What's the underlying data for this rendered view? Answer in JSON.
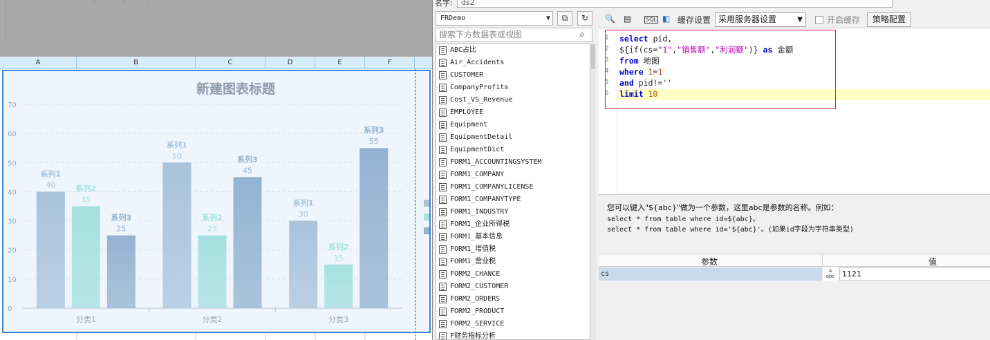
{
  "designer": {
    "columns": [
      "A",
      "B",
      "C",
      "D",
      "E",
      "F"
    ]
  },
  "chart": {
    "title": "新建图表标题",
    "y_ticks": [
      "70",
      "60",
      "50",
      "40",
      "30",
      "20",
      "10",
      "0"
    ]
  },
  "chart_data": {
    "type": "bar",
    "title": "新建图表标题",
    "categories": [
      "分类1",
      "分类2",
      "分类3"
    ],
    "series": [
      {
        "name": "系列1",
        "values": [
          40,
          50,
          30
        ],
        "color": "#a9c3dc"
      },
      {
        "name": "系列2",
        "values": [
          35,
          25,
          15
        ],
        "color": "#a6e0e0"
      },
      {
        "name": "系列3",
        "values": [
          25,
          45,
          55
        ],
        "color": "#94b3d2"
      }
    ],
    "ylim": [
      0,
      70
    ],
    "grid": true,
    "legend": "right"
  },
  "dataset": {
    "name_label": "名字:",
    "name_value": "ds2",
    "database": "FRDemo",
    "search_placeholder": "搜索下方数据表或视图",
    "tables": [
      "ABC占比",
      "Air_Accidents",
      "CUSTOMER",
      "CompanyProfits",
      "Cost_VS_Revenue",
      "EMPLOYEE",
      "Equipment",
      "EquipmentDetail",
      "EquipmentDict",
      "FORM1_ACCOUNTINGSYSTEM",
      "FORM1_COMPANY",
      "FORM1_COMPANYLICENSE",
      "FORM1_COMPANYTYPE",
      "FORM1_INDUSTRY",
      "FORM1_企业所得税",
      "FORM1_基本信息",
      "FORM1_增值税",
      "FORM1_营业税",
      "FORM2_CHANCE",
      "FORM2_CUSTOMER",
      "FORM2_ORDERS",
      "FORM2_PRODUCT",
      "FORM2_SERVICE",
      "F财务指标分析"
    ]
  },
  "editor": {
    "cache_settings_label": "缓存设置",
    "cache_option": "采用服务器设置",
    "enable_cache_label": "开启缓存",
    "strategy_button": "策略配置",
    "sql_lines": [
      "select pid,",
      "${if(cs=\"1\",\"销售额\",\"利润额\")} as 金额",
      "from 地图",
      "where 1=1",
      "and pid!=''",
      "limit 10"
    ]
  },
  "help": {
    "line1": "您可以键入\"${abc}\"做为一个参数，这里abc是参数的名称。例如：",
    "line2": "select * from table where id=${abc}。",
    "line3": "select * from table where id='${abc}'。(如果id字段为字符串类型)"
  },
  "params": {
    "header_name": "参数",
    "header_value": "值",
    "rows": [
      {
        "name": "cs",
        "value": "1121"
      }
    ]
  }
}
